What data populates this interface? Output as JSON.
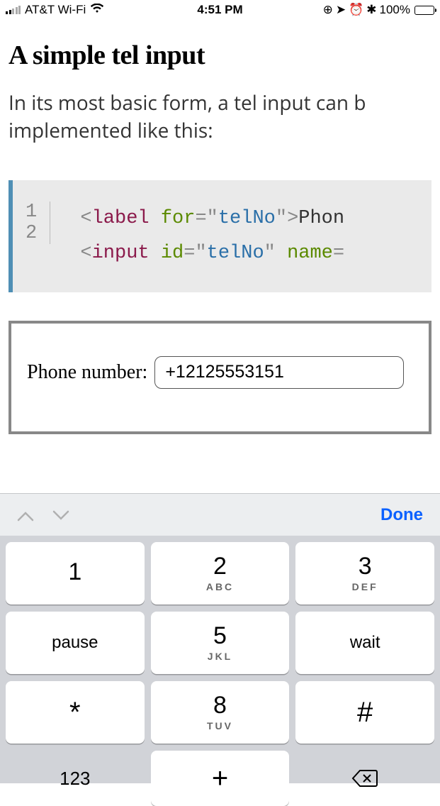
{
  "status": {
    "carrier": "AT&T Wi-Fi",
    "time": "4:51 PM",
    "battery_pct": "100%"
  },
  "page": {
    "title": "A simple tel input",
    "lead_line1": "In its most basic form, a tel input can b",
    "lead_line2": "implemented like this:"
  },
  "code": {
    "gutter": [
      "1",
      "2"
    ],
    "l1": {
      "p1": "<",
      "tag": "label",
      "sp": " ",
      "attr": "for",
      "eq": "=",
      "q": "\"",
      "str": "telNo",
      "q2": "\"",
      "p2": ">",
      "text": "Phon"
    },
    "l2": {
      "p1": "<",
      "tag": "input",
      "sp": " ",
      "attr1": "id",
      "eq": "=",
      "q": "\"",
      "str": "telNo",
      "q2": "\"",
      "sp2": "  ",
      "attr2": "name",
      "eq2": "="
    }
  },
  "example": {
    "label": "Phone number:",
    "input_value": "+12125553151"
  },
  "keyboard": {
    "done": "Done",
    "keys": {
      "k1": {
        "d": "1",
        "s": ""
      },
      "k2": {
        "d": "2",
        "s": "ABC"
      },
      "k3": {
        "d": "3",
        "s": "DEF"
      },
      "k4": {
        "d": "pause",
        "s": ""
      },
      "k5": {
        "d": "5",
        "s": "JKL"
      },
      "k6": {
        "d": "wait",
        "s": ""
      },
      "k7": {
        "d": "*",
        "s": ""
      },
      "k8": {
        "d": "8",
        "s": "TUV"
      },
      "k9": {
        "d": "#",
        "s": ""
      },
      "k10": {
        "d": "123"
      },
      "k11": {
        "d": "+"
      }
    }
  }
}
